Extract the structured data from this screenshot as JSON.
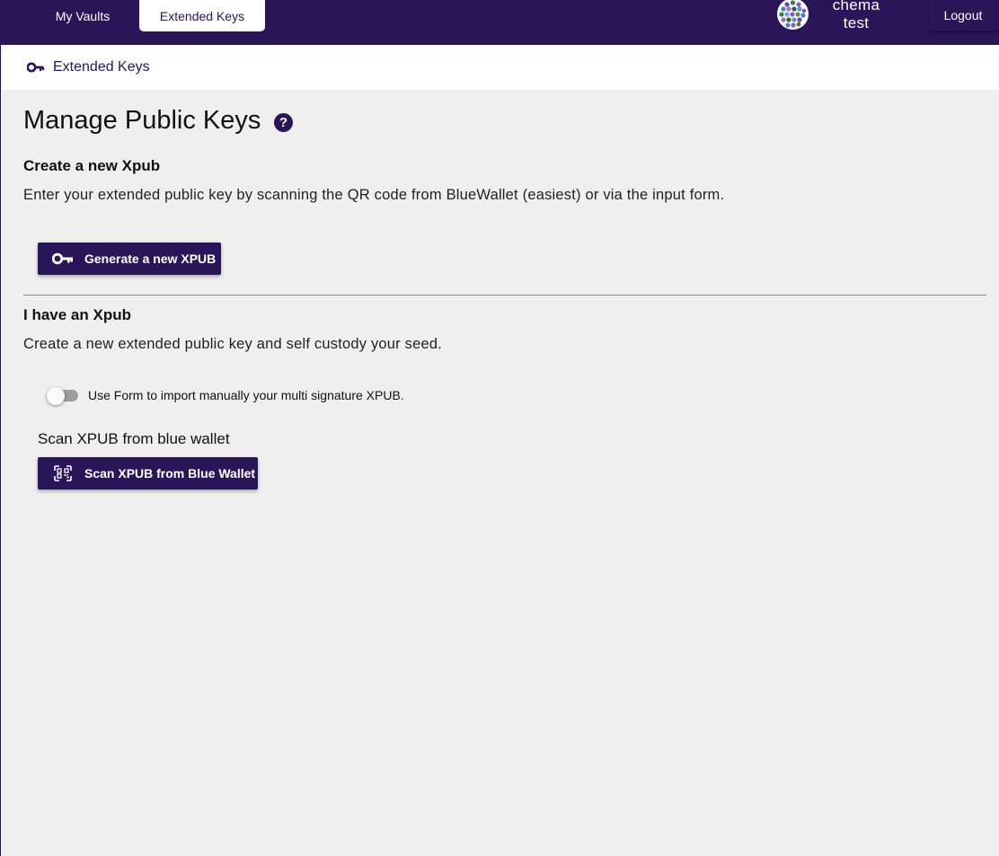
{
  "topbar": {
    "tabs": [
      {
        "label": "My Vaults",
        "active": false
      },
      {
        "label": "Extended Keys",
        "active": true
      }
    ],
    "user": {
      "first": "chema",
      "last": "test"
    },
    "logout_label": "Logout"
  },
  "breadcrumb": {
    "label": "Extended Keys",
    "icon": "key-icon"
  },
  "page": {
    "title": "Manage Public Keys",
    "help_icon": "?"
  },
  "create_section": {
    "title": "Create a new Xpub",
    "description": "Enter your extended public key by scanning the QR code from BlueWallet (easiest) or via the input form.",
    "button_label": "Generate a new XPUB"
  },
  "import_section": {
    "title": "I have an Xpub",
    "description": "Create a new extended public key and self custody your seed.",
    "toggle_label": "Use Form to import manually your multi signature XPUB.",
    "toggle_on": false,
    "scan_heading": "Scan XPUB from blue wallet",
    "scan_button_label": "Scan XPUB from Blue Wallet"
  },
  "colors": {
    "primary": "#2a1559",
    "background": "#efefef"
  }
}
